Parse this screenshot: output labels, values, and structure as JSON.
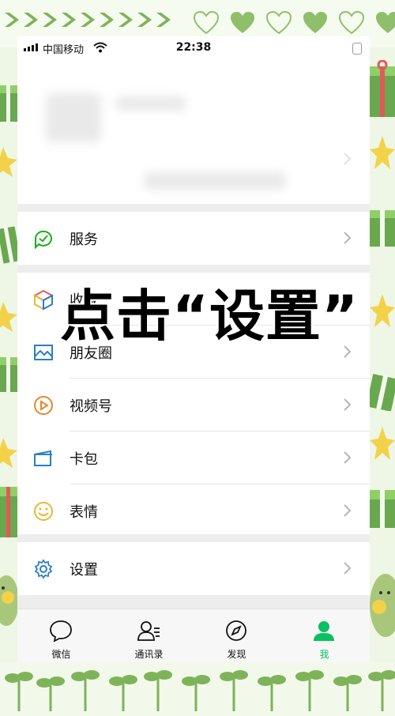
{
  "status_bar": {
    "carrier": "中国移动",
    "time": "22:38"
  },
  "menu": {
    "services": "服务",
    "favorites": "收藏",
    "moments": "朋友圈",
    "channels": "视频号",
    "cards": "卡包",
    "stickers": "表情",
    "settings": "设置"
  },
  "tabbar": {
    "chats": "微信",
    "contacts": "通讯录",
    "discover": "发现",
    "me": "我",
    "active_color": "#07c160"
  },
  "overlay": {
    "instruction": "点击“设置”"
  },
  "colors": {
    "frame_green": "#8fbf6a",
    "services_icon": "#1aad19",
    "moments_icon": "#2a7fc4",
    "channels_icon": "#e08a2c",
    "cards_icon": "#2a7fc4",
    "stickers_icon": "#e8b830",
    "settings_icon": "#2a7fc4"
  }
}
